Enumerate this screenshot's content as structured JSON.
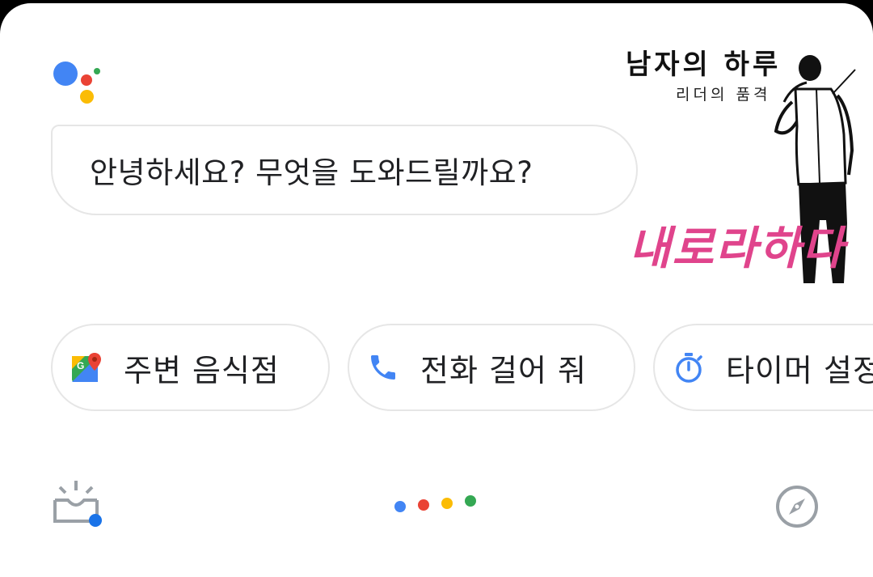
{
  "assistant": {
    "greeting": "안녕하세요? 무엇을 도와드릴까요?"
  },
  "watermark": {
    "title": "남자의 하루",
    "subtitle": "리더의 품격",
    "tagline": "내로라하다"
  },
  "suggestions": [
    {
      "label": "주변 음식점",
      "icon": "maps-icon"
    },
    {
      "label": "전화 걸어 줘",
      "icon": "phone-icon"
    },
    {
      "label": "타이머 설정",
      "icon": "timer-icon"
    }
  ],
  "bottom_bar": {
    "left_icon": "snapshot-tray-icon",
    "center_icon": "assistant-dots-icon",
    "right_icon": "explore-compass-icon"
  },
  "colors": {
    "blue": "#4285f4",
    "red": "#ea4335",
    "yellow": "#fbbc05",
    "green": "#34a853",
    "chip_border": "#e6e6e6",
    "tagline_pink": "#e0448c"
  }
}
